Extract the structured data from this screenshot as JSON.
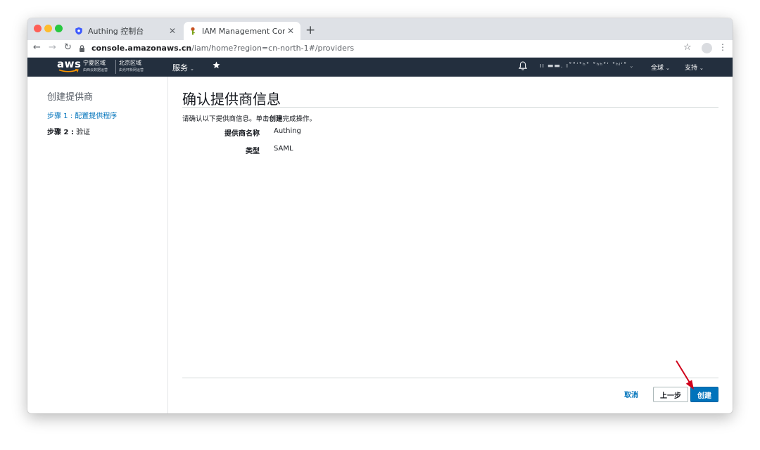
{
  "browser": {
    "tabs": [
      {
        "title": "Authing 控制台",
        "active": false,
        "favicon": "shield-favicon-icon"
      },
      {
        "title": "IAM Management Console",
        "active": true,
        "favicon": "key-favicon-icon"
      }
    ],
    "url_host": "console.amazonaws.cn",
    "url_path": "/iam/home?region=cn-north-1#/providers"
  },
  "aws_header": {
    "logo": "aws",
    "regions": [
      {
        "name": "宁夏区域",
        "operator": "由西云数据运营"
      },
      {
        "name": "北京区域",
        "operator": "由光环新网运营"
      }
    ],
    "services_label": "服务",
    "account_label": "ıı ▬▬. ı˚˚ʹ˚ʰ˚ ˚ʰʰ˚ʹ ˚ʰˡʹ˚",
    "global_label": "全球",
    "support_label": "支持"
  },
  "sidebar": {
    "title": "创建提供商",
    "step1": "步骤 1 : 配置提供程序",
    "step2_prefix": "步骤 2 :",
    "step2_label": "验证"
  },
  "main": {
    "title": "确认提供商信息",
    "instruction_before": "请确认以下提供商信息。单击",
    "instruction_bold": "创建",
    "instruction_after": "完成操作。",
    "fields": [
      {
        "label": "提供商名称",
        "value": "Authing"
      },
      {
        "label": "类型",
        "value": "SAML"
      }
    ]
  },
  "footer": {
    "cancel": "取消",
    "previous": "上一步",
    "create": "创建"
  },
  "colors": {
    "aws_header": "#232f3e",
    "aws_orange": "#ff9900",
    "link_blue": "#0073bb",
    "annotation_red": "#d0021b"
  }
}
